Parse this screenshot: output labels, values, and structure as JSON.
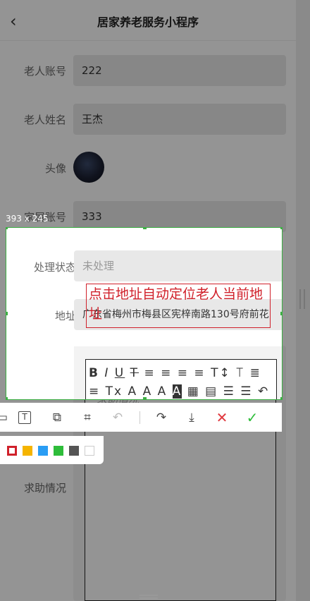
{
  "header": {
    "title": "居家养老服务小程序",
    "back_icon": "chevron-left-icon"
  },
  "form": {
    "elder_account": {
      "label": "老人账号",
      "value": "222"
    },
    "elder_name": {
      "label": "老人姓名",
      "value": "王杰"
    },
    "avatar": {
      "label": "头像"
    },
    "family_account": {
      "label": "家属账号",
      "value": "333"
    },
    "status": {
      "label": "处理状态",
      "placeholder": "未处理"
    },
    "address": {
      "label": "地址",
      "value": "广东省梅州市梅县区宪梓南路130号府前花"
    },
    "help": {
      "label": "求助情况",
      "placeholder": "求助情况"
    }
  },
  "editor_toolbar": [
    "B",
    "I",
    "U",
    "T",
    "≡",
    "≡",
    "≡",
    "≡",
    "T↕",
    "⟙",
    "≣",
    "≡",
    "Tx",
    "A",
    "A",
    "A",
    "A",
    "▦",
    "▤",
    "☰",
    "☰",
    "↶"
  ],
  "capture": {
    "size_label": "393 x 245",
    "annotation": "点击地址自动定位老人当前地址",
    "colors": [
      "#d0202a",
      "#f5b400",
      "#2a9df4",
      "#2ebd3a",
      "#555555",
      "#ffffff"
    ]
  }
}
